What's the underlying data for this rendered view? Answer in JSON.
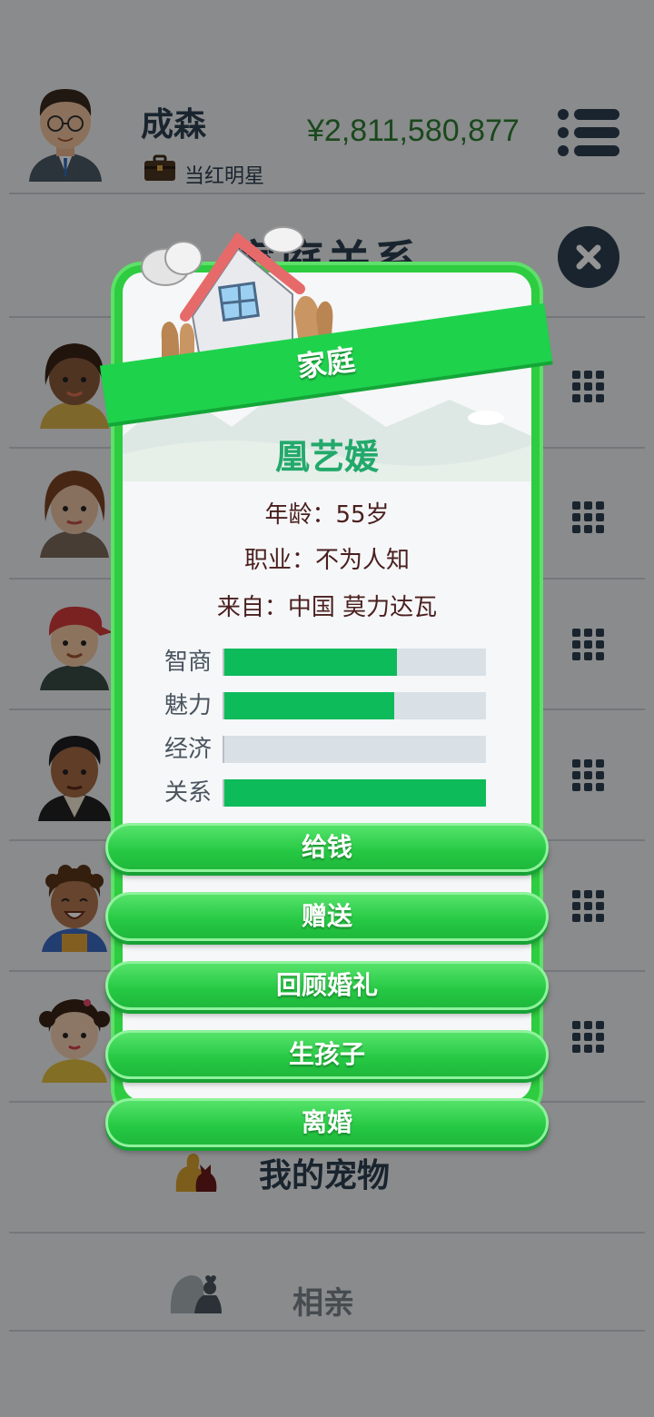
{
  "header": {
    "player_name": "成森",
    "job_title": "当红明星",
    "money": "¥2,811,580,877"
  },
  "section": {
    "title": "家庭关系"
  },
  "family_list": {
    "rows": [
      {
        "avatar": "woman-avatar-dark-skin"
      },
      {
        "avatar": "woman-avatar-brown-hair"
      },
      {
        "avatar": "boy-avatar-red-cap"
      },
      {
        "avatar": "man-avatar-dark-hair"
      },
      {
        "avatar": "child-avatar-curly-hair"
      },
      {
        "avatar": "girl-avatar-pigtails"
      }
    ]
  },
  "pets": {
    "label": "我的宠物"
  },
  "dating": {
    "label": "相亲"
  },
  "modal": {
    "banner_title": "家庭",
    "person_name": "凰艺媛",
    "age_key": "年龄：",
    "age_value": "55岁",
    "job_key": "职业：",
    "job_value": "不为人知",
    "from_key": "来自：",
    "from_value": "中国 莫力达瓦",
    "stats": [
      {
        "label": "智商",
        "value": 0.66
      },
      {
        "label": "魅力",
        "value": 0.65
      },
      {
        "label": "经济",
        "value": 0.0
      },
      {
        "label": "关系",
        "value": 1.0
      }
    ],
    "actions": [
      {
        "label": "给钱"
      },
      {
        "label": "赠送"
      },
      {
        "label": "回顾婚礼"
      },
      {
        "label": "生孩子"
      },
      {
        "label": "离婚"
      }
    ]
  },
  "colors": {
    "accent_green": "#2ecc40",
    "stat_fill": "#0dbb5a",
    "money_green": "#2e7d32",
    "name_green": "#22a96b"
  }
}
